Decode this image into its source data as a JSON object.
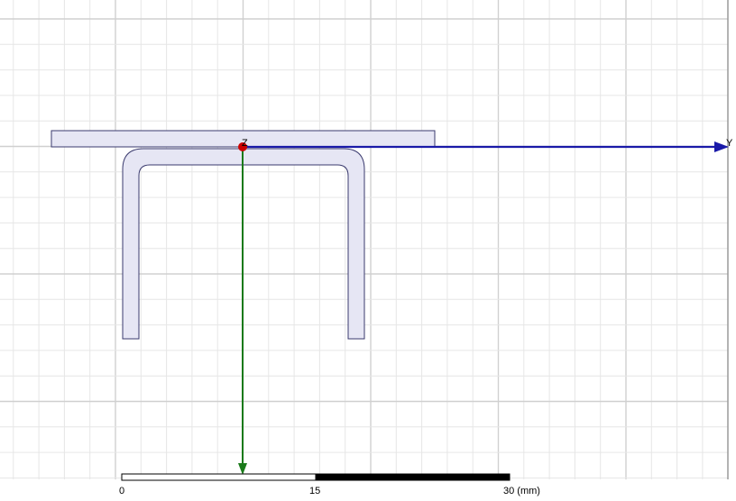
{
  "axes": {
    "y_label": "Y",
    "z_label": "Z",
    "y_color": "#1a1aa8",
    "x_color": "#1a7a1a",
    "origin_color": "#cc0000"
  },
  "geometry_colors": {
    "fill": "#e6e6f4",
    "stroke": "#3a3a6e"
  },
  "grid": {
    "minor_color": "#e6e6e6",
    "major_color": "#d0d0d0"
  },
  "scale_bar": {
    "ticks": [
      "0",
      "15",
      "30 (mm)"
    ]
  }
}
